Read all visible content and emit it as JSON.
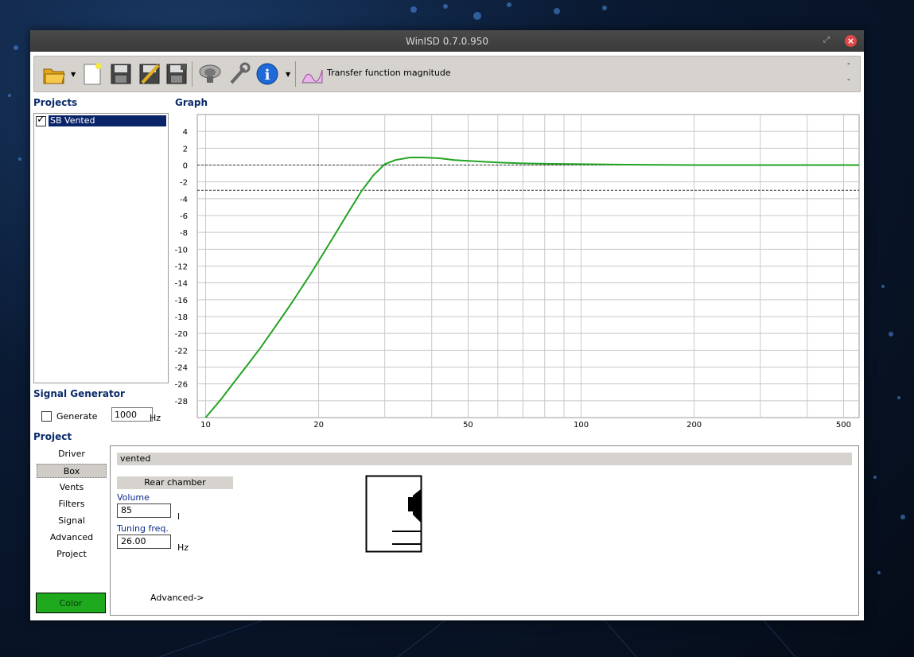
{
  "window": {
    "title": "WinISD 0.7.0.950"
  },
  "toolbar": {
    "graph_label": "Transfer function magnitude",
    "icons": [
      "open-folder-icon",
      "new-document-icon",
      "save-icon",
      "edit-save-icon",
      "save-as-icon",
      "speaker-driver-icon",
      "wrench-icon",
      "info-icon",
      "graph-icon"
    ],
    "dash": "-"
  },
  "projects": {
    "title": "Projects",
    "items": [
      {
        "label": "SB Vented",
        "checked": true
      }
    ]
  },
  "signal_generator": {
    "title": "Signal Generator",
    "generate_label": "Generate",
    "frequency_value": "1000",
    "unit": "Hz"
  },
  "graph": {
    "title": "Graph"
  },
  "chart_data": {
    "type": "line",
    "xscale": "log",
    "xlim": [
      9.5,
      550
    ],
    "ylim": [
      -30,
      6
    ],
    "yticks": [
      4,
      2,
      0,
      -2,
      -4,
      -6,
      -8,
      -10,
      -12,
      -14,
      -16,
      -18,
      -20,
      -22,
      -24,
      -26,
      -28
    ],
    "xticks": [
      10,
      20,
      50,
      100,
      200,
      500
    ],
    "grid": true,
    "ref_lines": [
      0,
      -3
    ],
    "series": [
      {
        "color": "#22a322",
        "x": [
          10,
          11,
          12,
          13,
          14,
          15,
          16,
          17,
          18,
          19,
          20,
          22,
          24,
          26,
          28,
          30,
          32,
          35,
          38,
          42,
          46,
          50,
          60,
          70,
          80,
          100,
          130,
          200,
          300,
          550
        ],
        "y": [
          -30,
          -27.8,
          -25.6,
          -23.6,
          -21.7,
          -19.8,
          -18.0,
          -16.3,
          -14.6,
          -13.0,
          -11.4,
          -8.4,
          -5.6,
          -3.1,
          -1.2,
          0.1,
          0.6,
          0.9,
          0.9,
          0.8,
          0.6,
          0.5,
          0.3,
          0.2,
          0.15,
          0.1,
          0.05,
          0,
          0,
          0
        ]
      }
    ]
  },
  "project": {
    "title": "Project",
    "nav": [
      "Driver",
      "Box",
      "Vents",
      "Filters",
      "Signal",
      "Advanced",
      "Project"
    ],
    "selected": "Box",
    "color_button": "Color",
    "color": "#1ea91e"
  },
  "box_panel": {
    "type_label": "vented",
    "rear_chamber_label": "Rear chamber",
    "volume_label": "Volume",
    "volume_value": "85",
    "volume_unit": "l",
    "tuning_label": "Tuning freq.",
    "tuning_value": "26.00",
    "tuning_unit": "Hz",
    "advanced_link": "Advanced->"
  }
}
